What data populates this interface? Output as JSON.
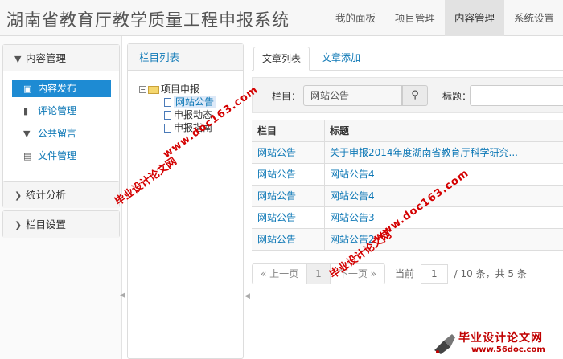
{
  "app": {
    "title": "湖南省教育厅教学质量工程申报系统"
  },
  "topnav": [
    "我的面板",
    "项目管理",
    "内容管理",
    "系统设置"
  ],
  "sidebar": {
    "content_panel": {
      "title": "内容管理",
      "items": [
        {
          "label": "内容发布",
          "icon": "briefcase-icon",
          "active": true
        },
        {
          "label": "评论管理",
          "icon": "comment-icon"
        },
        {
          "label": "公共留言",
          "icon": "filter-icon"
        },
        {
          "label": "文件管理",
          "icon": "folder-open-icon"
        }
      ]
    },
    "stats_panel": {
      "title": "统计分析"
    },
    "column_panel": {
      "title": "栏目设置"
    }
  },
  "tree": {
    "header": "栏目列表",
    "root": "项目申报",
    "children": [
      "网站公告",
      "申报动态",
      "申报指南"
    ]
  },
  "tabs": [
    "文章列表",
    "文章添加"
  ],
  "filter": {
    "column_label": "栏目：",
    "column_value": "网站公告",
    "title_label": "标题："
  },
  "table": {
    "headers": [
      "栏目",
      "标题"
    ],
    "rows": [
      [
        "网站公告",
        "关于申报2014年度湖南省教育厅科学研究..."
      ],
      [
        "网站公告",
        "网站公告4"
      ],
      [
        "网站公告",
        "网站公告4"
      ],
      [
        "网站公告",
        "网站公告3"
      ],
      [
        "网站公告",
        "网站公告2"
      ]
    ]
  },
  "pager": {
    "prev": "« 上一页",
    "current": "1",
    "next": "下一页 »",
    "info_prefix": "当前",
    "page_value": "1",
    "info_total": "/ 10 条，共 5 条"
  },
  "watermarks": {
    "doc_url_1": "www.doc163.com",
    "doc_cn_1": "毕业设计论文网",
    "doc_url_2": "www.doc163.com",
    "doc_cn_2": "毕业设计论文网",
    "logo_title": "毕业设计论文网",
    "logo_url": "www.56doc.com"
  },
  "colors": {
    "accent": "#1e8bd3",
    "link": "#0e78b6",
    "watermark": "#d40000"
  }
}
